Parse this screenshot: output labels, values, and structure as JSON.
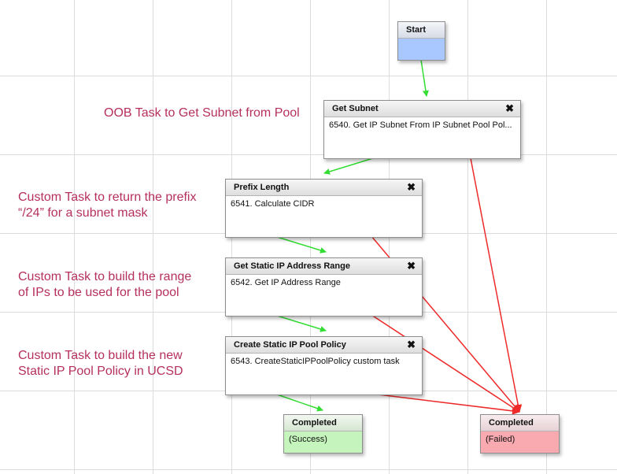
{
  "colors": {
    "success_edge": "#33dd33",
    "failure_edge": "#ee2a2a",
    "annotation_text": "#b5305e",
    "start_fill": "#a9c8ff",
    "completed_success_fill": "#c5f5bc",
    "completed_failed_fill": "#f9a9b0"
  },
  "annotations": {
    "get_subnet": "OOB Task to Get Subnet from Pool",
    "prefix_line1": "Custom Task to return the prefix",
    "prefix_line2": "“/24” for a subnet mask",
    "range_line1": "Custom Task to build the range",
    "range_line2": "of IPs to be used for the pool",
    "policy_line1": "Custom Task to build the new",
    "policy_line2": "Static IP Pool Policy in UCSD"
  },
  "start": {
    "title": "Start"
  },
  "tasks": {
    "get_subnet": {
      "title": "Get Subnet",
      "body": "6540. Get IP Subnet From IP Subnet Pool Pol..."
    },
    "prefix_length": {
      "title": "Prefix Length",
      "body": "6541. Calculate CIDR"
    },
    "ip_range": {
      "title": "Get Static IP Address Range",
      "body": "6542. Get IP Address Range"
    },
    "pool_policy": {
      "title": "Create Static IP Pool Policy",
      "body": "6543. CreateStaticIPPoolPolicy custom task"
    }
  },
  "close_symbol": "✖",
  "completed_success": {
    "title": "Completed",
    "status": "(Success)"
  },
  "completed_failed": {
    "title": "Completed",
    "status": "(Failed)"
  }
}
